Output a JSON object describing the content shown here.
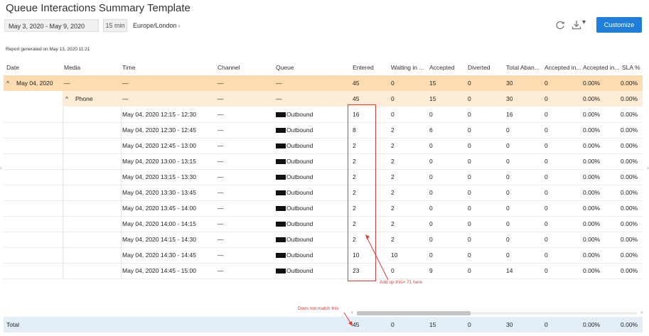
{
  "page": {
    "title": "Queue Interactions Summary Template",
    "report_generated": "Report generated on May 13, 2020 11:21"
  },
  "toolbar": {
    "date_range": "May 3, 2020 - May 9, 2020",
    "interval": "15 min",
    "timezone": "Europe/London",
    "timezone_caret": "›",
    "customize_label": "Customize",
    "download_caret": "▾"
  },
  "table": {
    "headers": [
      "Date",
      "Media",
      "Time",
      "Channel",
      "Queue",
      "Entered",
      "Waiting in ...",
      "Accepted",
      "Diverted",
      "Total Aban...",
      "Accepted in...",
      "Accepted in...",
      "SLA %"
    ],
    "group_date": {
      "toggle": "^",
      "date": "May 04, 2020",
      "media": "—",
      "time": "—",
      "channel": "—",
      "queue": "—",
      "values": [
        "45",
        "0",
        "15",
        "0",
        "30",
        "0",
        "0.00%",
        "0.00%"
      ]
    },
    "group_media": {
      "toggle": "^",
      "media": "Phone",
      "time": "—",
      "channel": "—",
      "queue": "—",
      "values": [
        "45",
        "0",
        "15",
        "0",
        "30",
        "0",
        "0.00%",
        "0.00%"
      ]
    },
    "rows": [
      {
        "time": "May 04, 2020 12:15 - 12:30",
        "channel": "—",
        "queue": "Outbound",
        "values": [
          "16",
          "0",
          "0",
          "0",
          "16",
          "0",
          "0.00%",
          "0.00%"
        ]
      },
      {
        "time": "May 04, 2020 12:30 - 12:45",
        "channel": "—",
        "queue": "Outbound",
        "values": [
          "8",
          "2",
          "6",
          "0",
          "0",
          "0",
          "0.00%",
          "0.00%"
        ]
      },
      {
        "time": "May 04, 2020 12:45 - 13:00",
        "channel": "—",
        "queue": "Outbound",
        "values": [
          "2",
          "2",
          "0",
          "0",
          "0",
          "0",
          "0.00%",
          "0.00%"
        ]
      },
      {
        "time": "May 04, 2020 13:00 - 13:15",
        "channel": "—",
        "queue": "Outbound",
        "values": [
          "2",
          "2",
          "0",
          "0",
          "0",
          "0",
          "0.00%",
          "0.00%"
        ]
      },
      {
        "time": "May 04, 2020 13:15 - 13:30",
        "channel": "—",
        "queue": "Outbound",
        "values": [
          "2",
          "2",
          "0",
          "0",
          "0",
          "0",
          "0.00%",
          "0.00%"
        ]
      },
      {
        "time": "May 04, 2020 13:30 - 13:45",
        "channel": "—",
        "queue": "Outbound",
        "values": [
          "2",
          "2",
          "0",
          "0",
          "0",
          "0",
          "0.00%",
          "0.00%"
        ]
      },
      {
        "time": "May 04, 2020 13:45 - 14:00",
        "channel": "—",
        "queue": "Outbound",
        "values": [
          "2",
          "2",
          "0",
          "0",
          "0",
          "0",
          "0.00%",
          "0.00%"
        ]
      },
      {
        "time": "May 04, 2020 14:00 - 14:15",
        "channel": "—",
        "queue": "Outbound",
        "values": [
          "2",
          "2",
          "0",
          "0",
          "0",
          "0",
          "0.00%",
          "0.00%"
        ]
      },
      {
        "time": "May 04, 2020 14:15 - 14:30",
        "channel": "—",
        "queue": "Outbound",
        "values": [
          "2",
          "2",
          "0",
          "0",
          "0",
          "0",
          "0.00%",
          "0.00%"
        ]
      },
      {
        "time": "May 04, 2020 14:30 - 14:45",
        "channel": "—",
        "queue": "Outbound",
        "values": [
          "10",
          "10",
          "0",
          "0",
          "0",
          "0",
          "0.00%",
          "0.00%"
        ]
      },
      {
        "time": "May 04, 2020 14:45 - 15:00",
        "channel": "—",
        "queue": "Outbound",
        "values": [
          "23",
          "0",
          "9",
          "0",
          "14",
          "0",
          "0.00%",
          "0.00%"
        ]
      }
    ],
    "total": {
      "label": "Total",
      "values": [
        "45",
        "0",
        "15",
        "0",
        "30",
        "0",
        "0.00%",
        "0.00%"
      ]
    }
  },
  "annotations": {
    "add_up_text": "Add up this= 71 here",
    "mismatch_text": "Does not match this",
    "color": "#e03a3a"
  },
  "colors": {
    "accent": "#1f7fd8",
    "group_date_bg": "#fcdcb0",
    "group_media_bg": "#fdecd6",
    "total_bg": "#e4eef9"
  }
}
